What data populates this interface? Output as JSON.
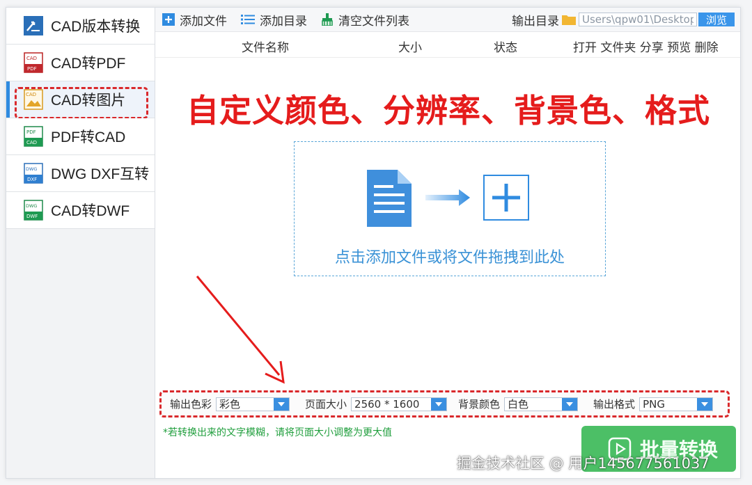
{
  "sidebar": {
    "items": [
      {
        "label": "CAD版本转换",
        "icon": "cad-version-icon"
      },
      {
        "label": "CAD转PDF",
        "icon": "cad-to-pdf-icon"
      },
      {
        "label": "CAD转图片",
        "icon": "cad-to-image-icon",
        "active": true
      },
      {
        "label": "PDF转CAD",
        "icon": "pdf-to-cad-icon"
      },
      {
        "label": "DWG DXF互转",
        "icon": "dwg-dxf-icon"
      },
      {
        "label": "CAD转DWF",
        "icon": "cad-to-dwf-icon"
      }
    ]
  },
  "toolbar": {
    "add_file": "添加文件",
    "add_folder": "添加目录",
    "clear_list": "清空文件列表",
    "output_dir_label": "输出目录",
    "output_path": "Users\\qpw01\\Desktop",
    "browse": "浏览"
  },
  "table_header": {
    "file_name": "文件名称",
    "size": "大小",
    "status": "状态",
    "actions": "打开 文件夹 分享 预览 删除"
  },
  "headline": "自定义颜色、分辨率、背景色、格式",
  "drop_zone": {
    "text": "点击添加文件或将文件拖拽到此处"
  },
  "options": {
    "color_label": "输出色彩",
    "color_value": "彩色",
    "page_size_label": "页面大小",
    "page_size_value": "2560 * 1600",
    "bg_label": "背景颜色",
    "bg_value": "白色",
    "format_label": "输出格式",
    "format_value": "PNG"
  },
  "hint": "*若转换出来的文字模糊，请将页面大小调整为更大值",
  "convert_button": "批量转换",
  "watermark": "掘金技术社区 @ 用户145677561037",
  "colors": {
    "accent": "#2f8be0",
    "highlight": "#e51c1c",
    "success": "#3dba5a"
  }
}
